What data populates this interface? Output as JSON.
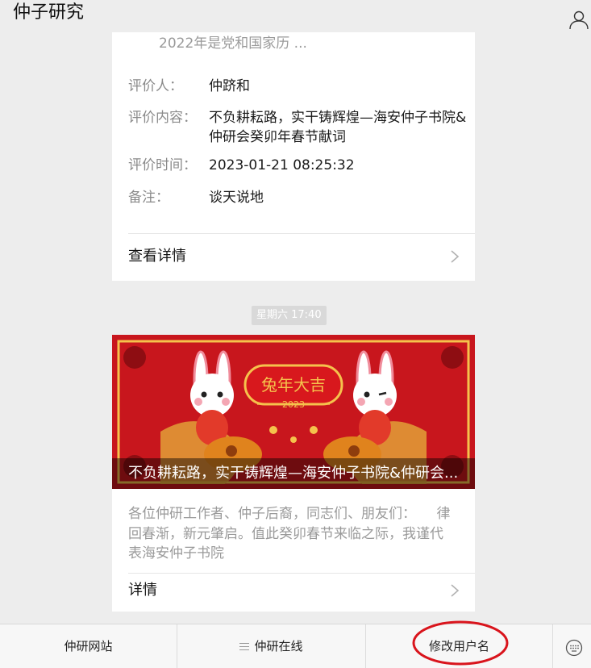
{
  "header": {
    "title": "仲子研究",
    "profile_icon": "user-icon"
  },
  "card1": {
    "clipped_text": "2022年是党和国家历 ...",
    "rows": [
      {
        "label": "评价人：",
        "value": "仲跻和"
      },
      {
        "label": "评价内容：",
        "value": "不负耕耘路，实干铸辉煌—海安仲子书院&仲研会癸卯年春节献词"
      },
      {
        "label": "评价时间：",
        "value": "2023-01-21 08:25:32"
      },
      {
        "label": "备注：",
        "value": "谈天说地"
      }
    ],
    "detail_label": "查看详情"
  },
  "timestamp": "星期六 17:40",
  "card2": {
    "cover": {
      "banner_text": "兔年大吉",
      "year_text": "2023",
      "colors": {
        "bg": "#c8161d",
        "gold": "#f5c24c",
        "dark_red": "#8e0d12"
      }
    },
    "title": "不负耕耘路，实干铸辉煌—海安仲子书院&仲研会...",
    "digest": "各位仲研工作者、仲子后裔，同志们、朋友们：　　律回春渐，新元肇启。值此癸卯春节来临之际，我谨代表海安仲子书院",
    "detail_label": "详情"
  },
  "menu": {
    "items": [
      {
        "label": "仲研网站"
      },
      {
        "label": "仲研在线",
        "icon": "hamburger-icon"
      },
      {
        "label": "修改用户名"
      }
    ],
    "keyboard_icon": "keyboard-icon",
    "annotation_color": "#d9141c"
  }
}
